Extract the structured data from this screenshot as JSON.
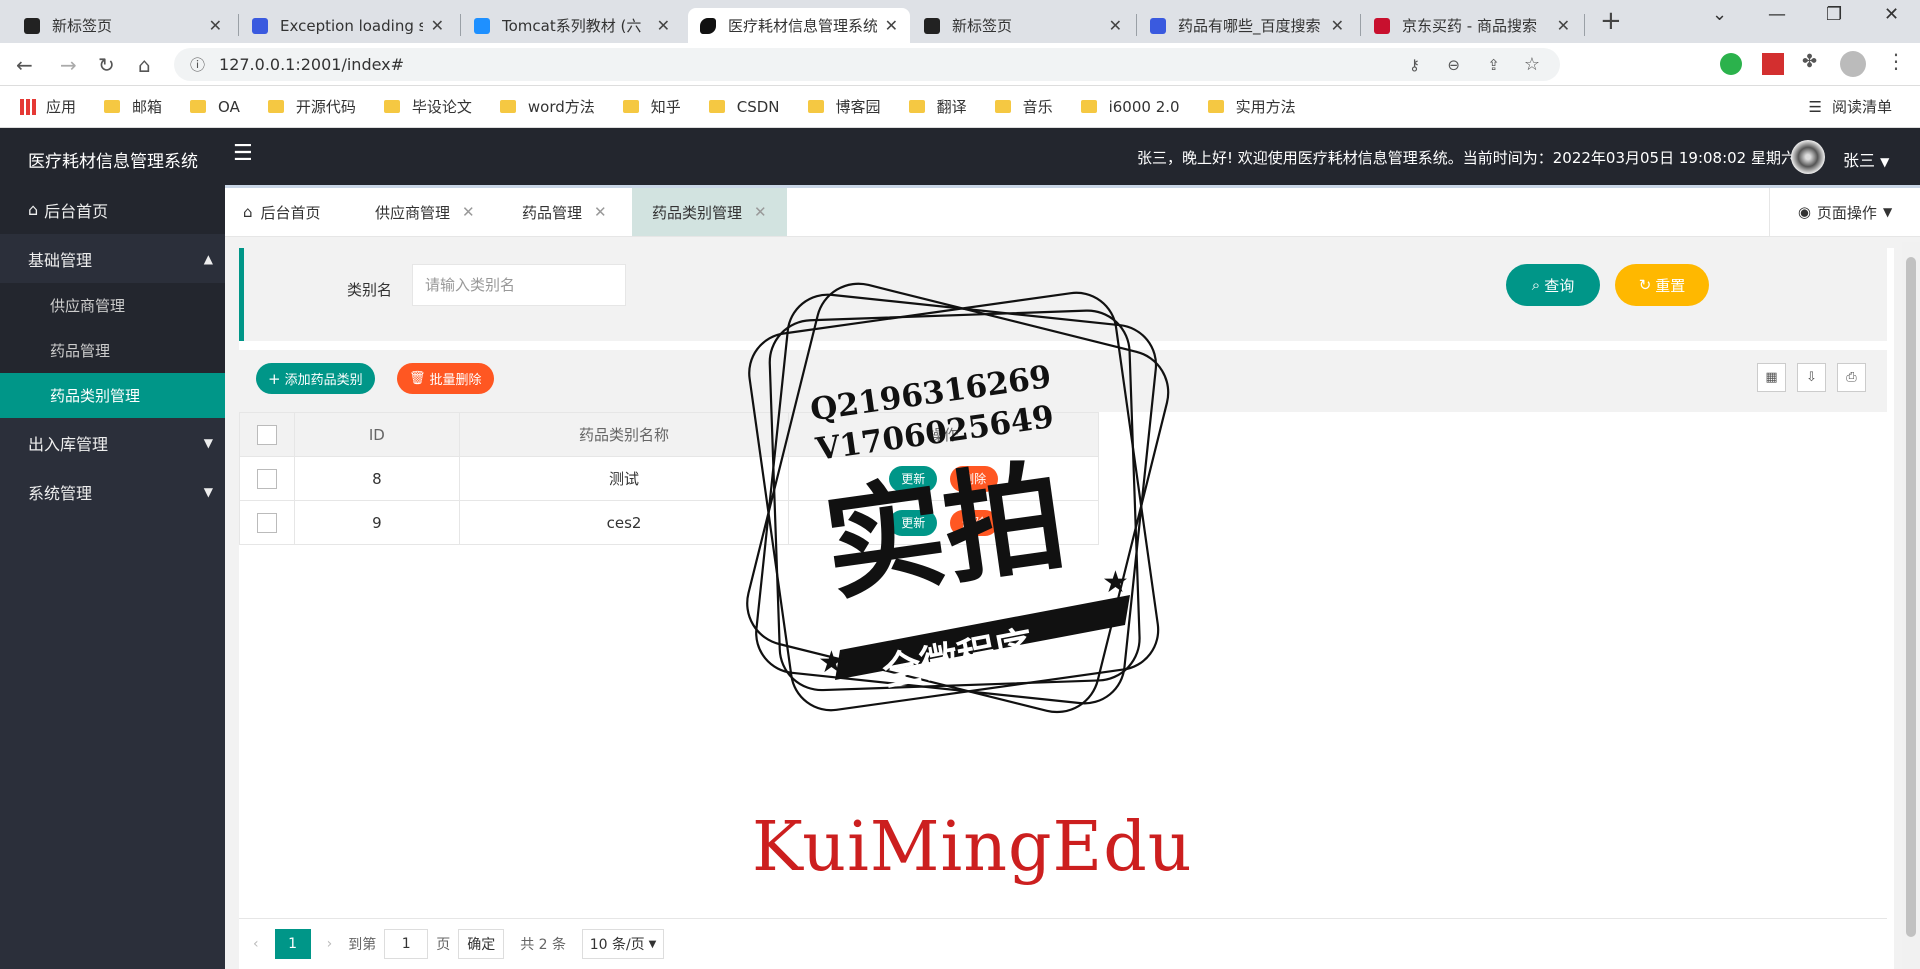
{
  "browser": {
    "tabs": [
      {
        "title": "新标签页",
        "active": false,
        "icon": "chrome-newtab-icon"
      },
      {
        "title": "Exception loading se",
        "active": false,
        "icon": "baidu-paw-icon"
      },
      {
        "title": "Tomcat系列教材 (六",
        "active": false,
        "icon": "tomcat-j-icon"
      },
      {
        "title": "医疗耗材信息管理系统",
        "active": true,
        "icon": "horse-icon"
      },
      {
        "title": "新标签页",
        "active": false,
        "icon": "chrome-newtab-icon"
      },
      {
        "title": "药品有哪些_百度搜索",
        "active": false,
        "icon": "baidu-paw-icon"
      },
      {
        "title": "京东买药 - 商品搜索",
        "active": false,
        "icon": "jd-icon"
      }
    ],
    "url": "127.0.0.1:2001/index#",
    "bookmarks": [
      "应用",
      "邮箱",
      "OA",
      "开源代码",
      "毕设论文",
      "word方法",
      "知乎",
      "CSDN",
      "博客园",
      "翻译",
      "音乐",
      "i6000 2.0",
      "实用方法"
    ],
    "reading_list": "阅读清单"
  },
  "app": {
    "title": "医疗耗材信息管理系统",
    "welcome": "张三，晚上好! 欢迎使用医疗耗材信息管理系统。当前时间为：2022年03月05日 19:08:02 星期六",
    "user": "张三",
    "sidebar": {
      "home": "后台首页",
      "groups": [
        {
          "label": "基础管理",
          "expanded": true,
          "items": [
            "供应商管理",
            "药品管理",
            "药品类别管理"
          ]
        },
        {
          "label": "出入库管理",
          "expanded": false
        },
        {
          "label": "系统管理",
          "expanded": false
        }
      ]
    },
    "page_tabs": [
      "后台首页",
      "供应商管理",
      "药品管理",
      "药品类别管理"
    ],
    "page_op": "页面操作",
    "search": {
      "label": "类别名",
      "placeholder": "请输入类别名",
      "query": "查询",
      "reset": "重置"
    },
    "toolbar": {
      "add": "添加药品类别",
      "batch_delete": "批量删除"
    },
    "table": {
      "headers": [
        "ID",
        "药品类别名称",
        "操作"
      ],
      "rows": [
        {
          "id": "8",
          "name": "测试"
        },
        {
          "id": "9",
          "name": "ces2"
        }
      ],
      "row_actions": [
        "更新",
        "删除"
      ]
    },
    "pager": {
      "current": "1",
      "goto_label": "到第",
      "goto_value": "1",
      "page_unit": "页",
      "confirm": "确定",
      "total": "共 2 条",
      "page_size": "10 条/页"
    }
  },
  "watermarks": {
    "stamp_lines": [
      "Q2196316269",
      "V1706025649",
      "实拍",
      "全微程序"
    ],
    "brand": "KuiMingEdu"
  },
  "colors": {
    "primary": "#009688",
    "warm": "#FFB800",
    "danger": "#FF5722",
    "header": "#23262e",
    "sidebar": "#2b2f3a"
  }
}
